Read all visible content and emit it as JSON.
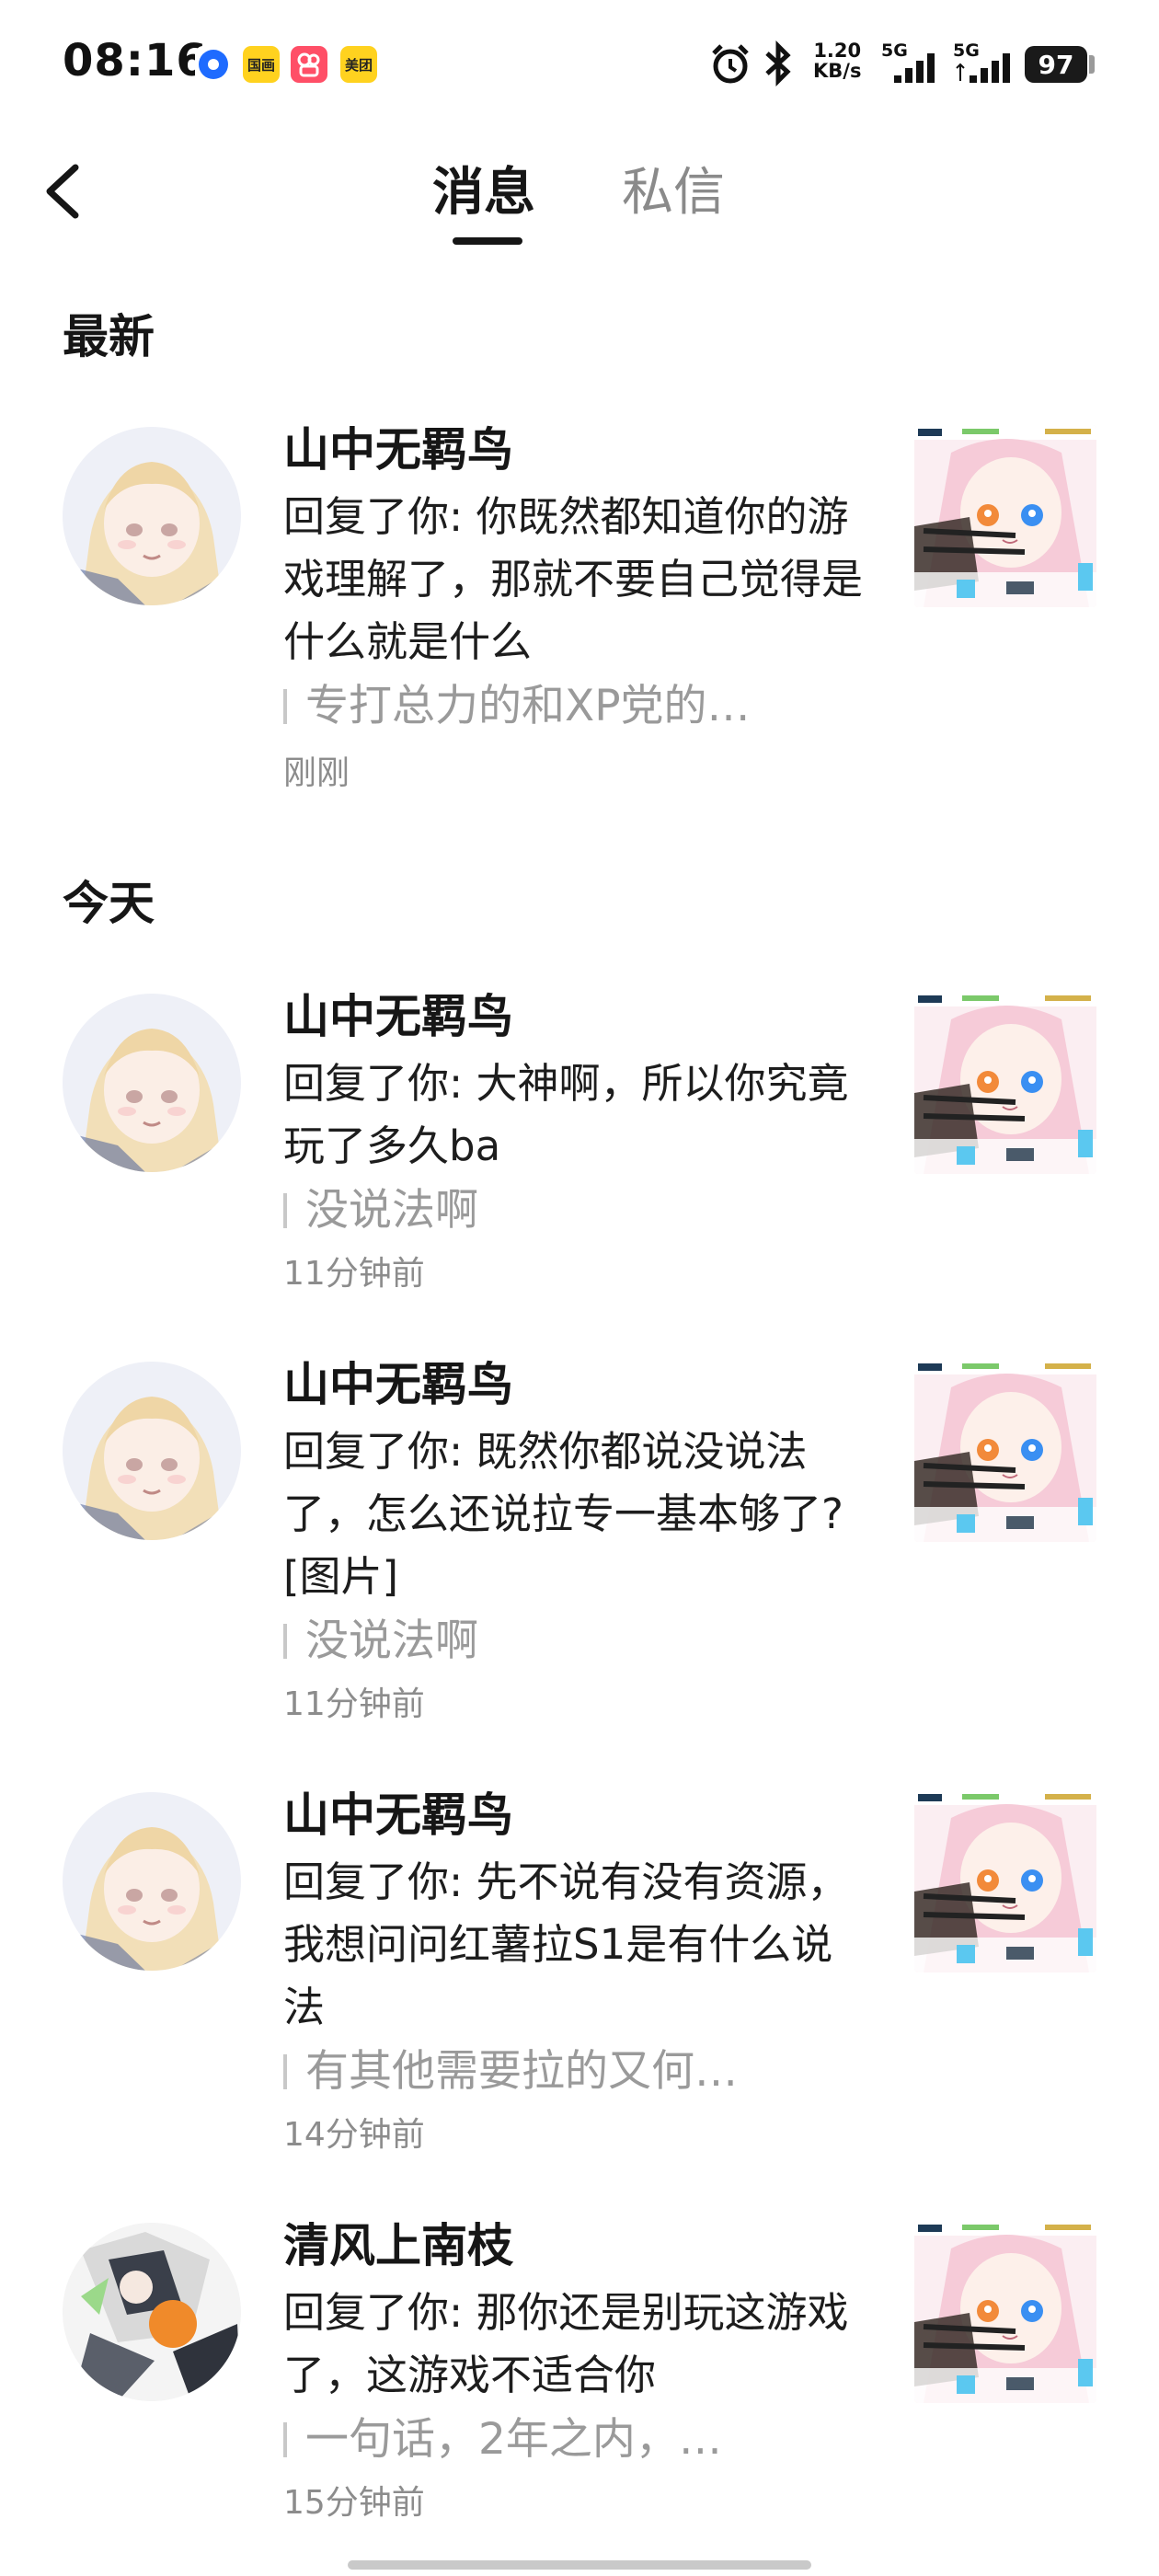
{
  "status_bar": {
    "time": "08:16",
    "app_icons": [
      "dot-app-icon",
      "guomei-icon",
      "kuaishou-icon",
      "meituan-icon"
    ],
    "app_labels": [
      "",
      "国画",
      "",
      "美团"
    ],
    "net_speed_value": "1.20",
    "net_speed_unit": "KB/s",
    "sim1": "5G",
    "sim2": "5G",
    "battery": "97"
  },
  "header": {
    "tabs": [
      {
        "label": "消息",
        "active": true
      },
      {
        "label": "私信",
        "active": false
      }
    ]
  },
  "sections": {
    "latest_title": "最新",
    "today_title": "今天"
  },
  "latest": [
    {
      "name": "山中无羁鸟",
      "reply": "回复了你: 你既然都知道你的游戏理解了，那就不要自己觉得是什么就是什么",
      "quote": "专打总力的和XP党的…",
      "time": "刚刚"
    }
  ],
  "today": [
    {
      "name": "山中无羁鸟",
      "reply": "回复了你: 大神啊，所以你究竟玩了多久ba",
      "quote": "没说法啊",
      "time": "11分钟前"
    },
    {
      "name": "山中无羁鸟",
      "reply": "回复了你: 既然你都说没说法了，怎么还说拉专一基本够了?[图片]",
      "quote": "没说法啊",
      "time": "11分钟前"
    },
    {
      "name": "山中无羁鸟",
      "reply": "回复了你: 先不说有没有资源，我想问问红薯拉S1是有什么说法",
      "quote": "有其他需要拉的又何…",
      "time": "14分钟前"
    },
    {
      "name": "清风上南枝",
      "reply": "回复了你: 那你还是别玩这游戏了，这游戏不适合你",
      "quote": "一句话，2年之内，…",
      "time": "15分钟前"
    }
  ],
  "colors": {
    "text_primary": "#161616",
    "text_secondary": "#8c8c8c",
    "quote_text": "#9a9a9a",
    "background": "#ffffff"
  }
}
